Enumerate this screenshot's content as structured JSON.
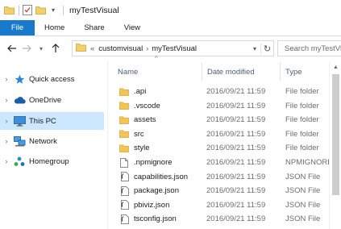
{
  "window": {
    "title": "myTestVisual"
  },
  "quick_access_toolbar": {
    "icons": [
      "folder-icon",
      "properties-check-icon",
      "new-folder-icon",
      "dropdown-chevron-icon"
    ]
  },
  "ribbon": {
    "file_tab": "File",
    "tabs": [
      "Home",
      "Share",
      "View"
    ]
  },
  "address": {
    "overflow": "«",
    "segments": [
      "customvisual",
      "myTestVisual"
    ],
    "separator": "›"
  },
  "search": {
    "placeholder": "Search myTestVisual"
  },
  "navigation": {
    "items": [
      {
        "label": "Quick access",
        "icon": "star-icon",
        "selected": false
      },
      {
        "label": "OneDrive",
        "icon": "cloud-icon",
        "selected": false
      },
      {
        "label": "This PC",
        "icon": "computer-icon",
        "selected": true
      },
      {
        "label": "Network",
        "icon": "network-icon",
        "selected": false
      },
      {
        "label": "Homegroup",
        "icon": "homegroup-icon",
        "selected": false
      }
    ]
  },
  "columns": {
    "name": "Name",
    "date": "Date modified",
    "type": "Type"
  },
  "files": [
    {
      "name": ".api",
      "date": "2016/09/21 11:59",
      "type": "File folder",
      "icon": "folder-icon"
    },
    {
      "name": ".vscode",
      "date": "2016/09/21 11:59",
      "type": "File folder",
      "icon": "folder-icon"
    },
    {
      "name": "assets",
      "date": "2016/09/21 11:59",
      "type": "File folder",
      "icon": "folder-icon"
    },
    {
      "name": "src",
      "date": "2016/09/21 11:59",
      "type": "File folder",
      "icon": "folder-icon"
    },
    {
      "name": "style",
      "date": "2016/09/21 11:59",
      "type": "File folder",
      "icon": "folder-icon"
    },
    {
      "name": ".npmignore",
      "date": "2016/09/21 11:59",
      "type": "NPMIGNORE File",
      "icon": "file-icon"
    },
    {
      "name": "capabilities.json",
      "date": "2016/09/21 11:59",
      "type": "JSON File",
      "icon": "json-file-icon"
    },
    {
      "name": "package.json",
      "date": "2016/09/21 11:59",
      "type": "JSON File",
      "icon": "json-file-icon"
    },
    {
      "name": "pbiviz.json",
      "date": "2016/09/21 11:59",
      "type": "JSON File",
      "icon": "json-file-icon"
    },
    {
      "name": "tsconfig.json",
      "date": "2016/09/21 11:59",
      "type": "JSON File",
      "icon": "json-file-icon"
    }
  ],
  "colors": {
    "accent": "#1979ca",
    "selection": "#cce8ff",
    "folder": "#e8b83c",
    "header_text": "#4c607a"
  }
}
